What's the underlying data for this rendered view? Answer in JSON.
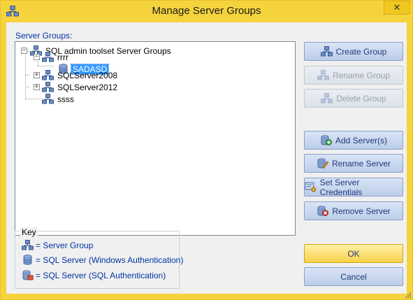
{
  "window": {
    "title": "Manage Server Groups",
    "close_glyph": "✕"
  },
  "tree": {
    "label": "Server Groups:",
    "nodes": [
      {
        "label": "SQL admin toolset Server Groups",
        "icon": "server-group-icon",
        "expander": "−"
      },
      {
        "label": "rrrr",
        "icon": "server-group-icon",
        "expander": "−"
      },
      {
        "label": "SADASD",
        "icon": "sql-server-windows-auth-icon",
        "selected": true
      },
      {
        "label": "SQLServer2008",
        "icon": "server-group-icon",
        "expander": "+"
      },
      {
        "label": "SQLServer2012",
        "icon": "server-group-icon",
        "expander": "+"
      },
      {
        "label": "ssss",
        "icon": "server-group-icon"
      }
    ]
  },
  "buttons": {
    "create_group": "Create Group",
    "rename_group": "Rename Group",
    "delete_group": "Delete Group",
    "add_servers": "Add Server(s)",
    "rename_server": "Rename Server",
    "set_credentials": "Set Server Credentials",
    "remove_server": "Remove Server",
    "ok": "OK",
    "cancel": "Cancel"
  },
  "key": {
    "title": "Key",
    "rows": [
      {
        "text": "= Server Group",
        "icon": "server-group-icon"
      },
      {
        "text": "= SQL Server (Windows Authentication)",
        "icon": "sql-server-windows-auth-icon"
      },
      {
        "text": "= SQL Server (SQL Authentication)",
        "icon": "sql-server-sql-auth-icon"
      }
    ]
  },
  "colors": {
    "title_bar": "#f5d33c",
    "accent_blue": "#0033a0",
    "selection": "#3399ff",
    "ok_button": "#f8d14a"
  }
}
